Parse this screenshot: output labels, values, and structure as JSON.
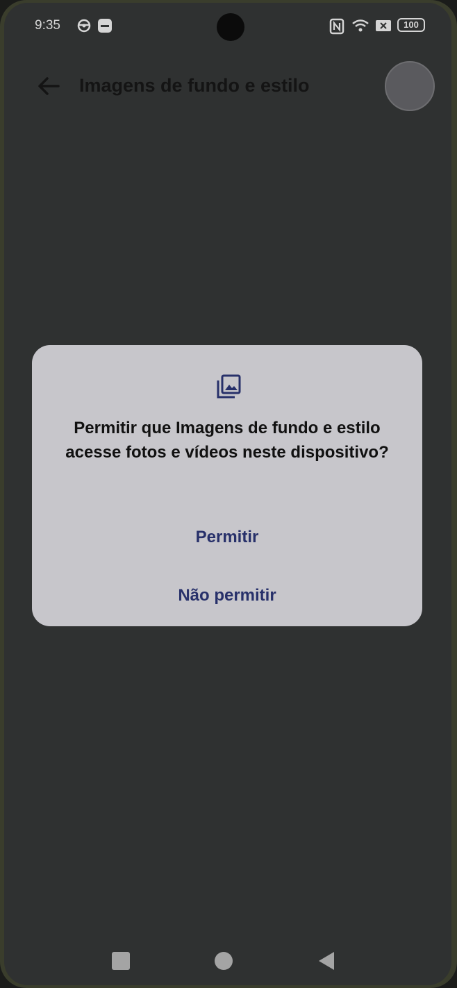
{
  "status_bar": {
    "time": "9:35",
    "battery": "100"
  },
  "app_bar": {
    "title": "Imagens de fundo e estilo"
  },
  "dialog": {
    "message": "Permitir que Imagens de fundo e estilo acesse fotos e vídeos neste dispositivo?",
    "allow_label": "Permitir",
    "deny_label": "Não permitir"
  },
  "icons": {
    "back": "arrow-left-icon",
    "photos": "photo-library-icon",
    "recents": "recents-square-icon",
    "home": "home-circle-icon",
    "nav_back": "back-triangle-icon"
  }
}
